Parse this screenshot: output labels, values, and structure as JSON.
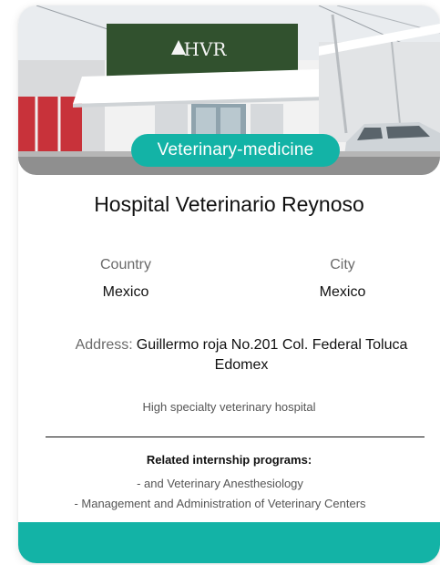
{
  "card": {
    "category": "Veterinary-medicine",
    "sign_text": "HVR",
    "title": "Hospital Veterinario Reynoso",
    "country": {
      "label": "Country",
      "value": "Mexico"
    },
    "city": {
      "label": "City",
      "value": "Mexico"
    },
    "address": {
      "label": "Address:",
      "value": "Guillermo roja No.201 Col. Federal Toluca Edomex"
    },
    "description": "High specialty veterinary hospital",
    "programs_title": "Related internship programs:",
    "programs": [
      "- and Veterinary Anesthesiology",
      "- Management and Administration of Veterinary Centers"
    ]
  },
  "colors": {
    "accent": "#13b3a6",
    "sign_green": "#2c4a2a",
    "wall_red": "#c8323a"
  }
}
